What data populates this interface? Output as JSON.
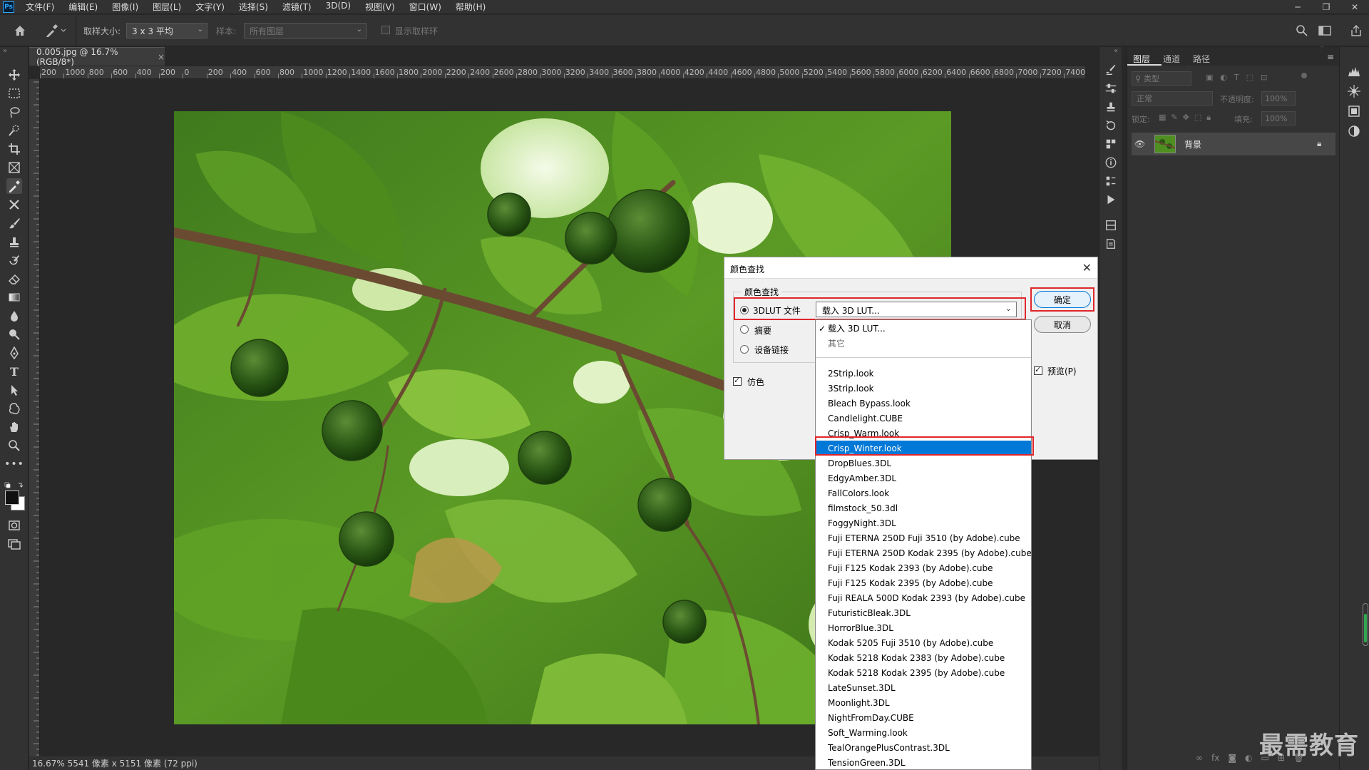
{
  "app": {
    "logo": "Ps"
  },
  "menu": [
    "文件(F)",
    "编辑(E)",
    "图像(I)",
    "图层(L)",
    "文字(Y)",
    "选择(S)",
    "滤镜(T)",
    "3D(D)",
    "视图(V)",
    "窗口(W)",
    "帮助(H)"
  ],
  "window_controls": {
    "minimize": "─",
    "restore": "❐",
    "close": "✕"
  },
  "options": {
    "sample_size_label": "取样大小:",
    "sample_size_value": "3 x 3 平均",
    "sample_label": "样本:",
    "sample_value": "所有图层",
    "show_ring_label": "显示取样环"
  },
  "document": {
    "tab_title": "0.005.jpg @ 16.7%(RGB/8*)",
    "tab_close": "×",
    "status": "16.67%  5541 像素 x 5151 像素 (72 ppi)"
  },
  "ruler": {
    "h_labels": [
      "200",
      "1000",
      "800",
      "600",
      "400",
      "200",
      "0",
      "200",
      "400",
      "600",
      "800",
      "1000",
      "1200",
      "1400",
      "1600",
      "1800",
      "2000",
      "2200",
      "2400",
      "2600",
      "2800",
      "3000",
      "3200",
      "3400",
      "3600",
      "3800",
      "4000",
      "4200",
      "4400",
      "4600",
      "4800",
      "5000",
      "5200",
      "5400",
      "5600",
      "5800",
      "6000",
      "6200",
      "6400",
      "6600",
      "6800",
      "7000",
      "7200",
      "7400",
      "7"
    ]
  },
  "layers_panel": {
    "tabs": [
      "图层",
      "通道",
      "路径"
    ],
    "filter_placeholder": "类型",
    "blend_mode": "正常",
    "opacity_label": "不透明度:",
    "opacity_value": "100%",
    "lock_label": "锁定:",
    "fill_label": "填充:",
    "fill_value": "100%",
    "layer_name": "背景"
  },
  "dialog": {
    "title": "颜色查找",
    "close": "✕",
    "group_label": "颜色查找",
    "radio_3dlut": "3DLUT 文件",
    "radio_abstract": "摘要",
    "radio_device_link": "设备链接",
    "dither_label": "仿色",
    "ok_button": "确定",
    "cancel_button": "取消",
    "preview_label": "预览(P)",
    "lut_field_value": "载入 3D LUT..."
  },
  "lut_dropdown": {
    "top_items": [
      {
        "label": "载入 3D LUT...",
        "checked": true
      },
      {
        "label": "其它",
        "checked": false
      }
    ],
    "items": [
      "2Strip.look",
      "3Strip.look",
      "Bleach Bypass.look",
      "Candlelight.CUBE",
      "Crisp_Warm.look",
      "Crisp_Winter.look",
      "DropBlues.3DL",
      "EdgyAmber.3DL",
      "FallColors.look",
      "filmstock_50.3dl",
      "FoggyNight.3DL",
      "Fuji ETERNA 250D Fuji 3510 (by Adobe).cube",
      "Fuji ETERNA 250D Kodak 2395 (by Adobe).cube",
      "Fuji F125 Kodak 2393 (by Adobe).cube",
      "Fuji F125 Kodak 2395 (by Adobe).cube",
      "Fuji REALA 500D Kodak 2393 (by Adobe).cube",
      "FuturisticBleak.3DL",
      "HorrorBlue.3DL",
      "Kodak 5205 Fuji 3510 (by Adobe).cube",
      "Kodak 5218 Kodak 2383 (by Adobe).cube",
      "Kodak 5218 Kodak 2395 (by Adobe).cube",
      "LateSunset.3DL",
      "Moonlight.3DL",
      "NightFromDay.CUBE",
      "Soft_Warming.look",
      "TealOrangePlusContrast.3DL",
      "TensionGreen.3DL"
    ],
    "selected_index": 5
  },
  "watermark": "最需教育",
  "colors": {
    "highlight": "#0078d7",
    "red_outline": "#e0262b",
    "ui_dark": "#323232"
  }
}
